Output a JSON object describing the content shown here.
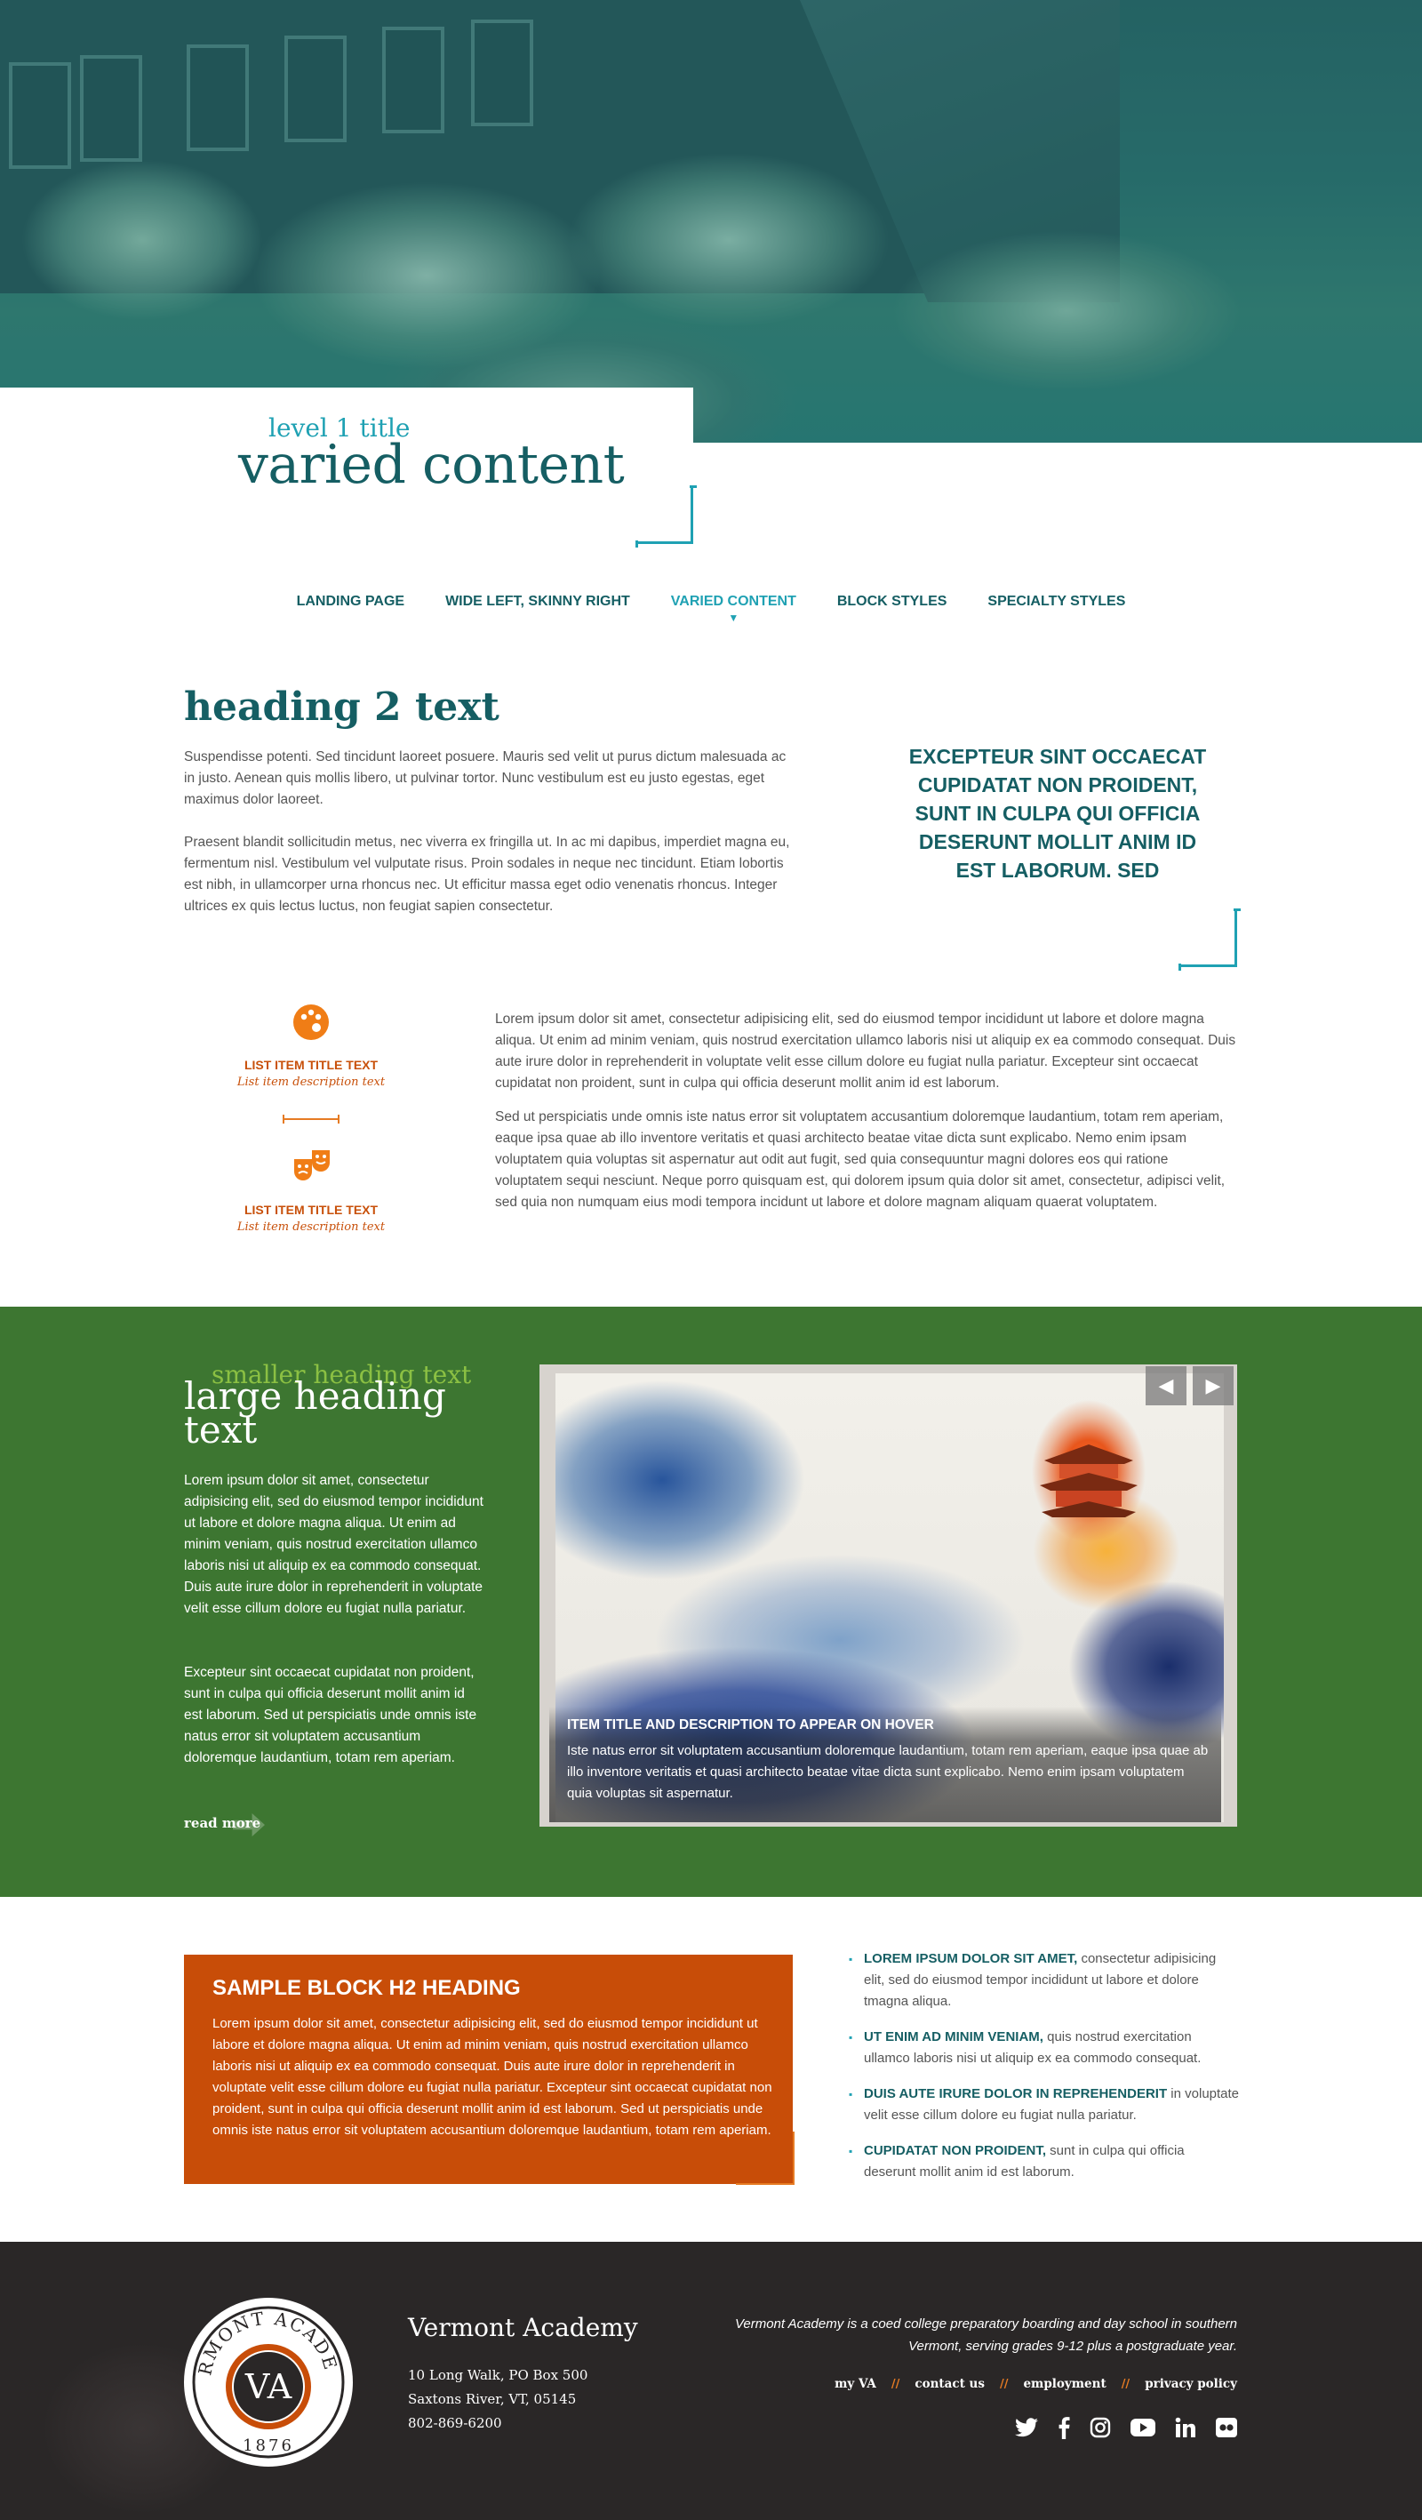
{
  "header": {
    "level1_title": "level 1 title",
    "page_title": "varied content"
  },
  "nav": {
    "items": [
      {
        "label": "LANDING PAGE"
      },
      {
        "label": "WIDE LEFT, SKINNY RIGHT"
      },
      {
        "label": "VARIED CONTENT",
        "active": true
      },
      {
        "label": "BLOCK STYLES"
      },
      {
        "label": "SPECIALTY STYLES"
      }
    ]
  },
  "intro": {
    "heading": "heading 2 text",
    "paragraph1": "Suspendisse potenti. Sed tincidunt laoreet posuere. Mauris sed velit ut purus dictum malesuada ac in justo. Aenean quis mollis libero, ut pulvinar tortor. Nunc vestibulum est eu justo egestas, eget maximus dolor laoreet.",
    "paragraph2": "Praesent blandit sollicitudin metus, nec viverra ex fringilla ut. In ac mi dapibus, imperdiet magna eu, fermentum nisl. Vestibulum vel vulputate risus. Proin sodales in neque nec tincidunt. Etiam lobortis est nibh, in ullamcorper urna rhoncus nec. Ut efficitur massa eget odio venenatis rhoncus. Integer ultrices ex quis lectus luctus, non feugiat sapien consectetur.",
    "pull_quote": "EXCEPTEUR SINT OCCAECAT CUPIDATAT NON PROIDENT, SUNT IN CULPA QUI OFFICIA DESERUNT MOLLIT ANIM ID EST LABORUM. SED"
  },
  "list_items": [
    {
      "icon": "palette-icon",
      "title": "LIST ITEM TITLE TEXT",
      "description": "List item description text"
    },
    {
      "icon": "theater-masks-icon",
      "title": "LIST ITEM TITLE TEXT",
      "description": "List item description text"
    }
  ],
  "body_text": {
    "paragraph1": "Lorem ipsum dolor sit amet, consectetur adipisicing elit, sed do eiusmod tempor incididunt ut labore et dolore magna aliqua. Ut enim ad minim veniam, quis nostrud exercitation ullamco laboris nisi ut aliquip ex ea commodo consequat. Duis aute irure dolor in reprehenderit in voluptate velit esse cillum dolore eu fugiat nulla pariatur. Excepteur sint occaecat cupidatat non proident, sunt in culpa qui officia deserunt mollit anim id est laborum.",
    "paragraph2": "Sed ut perspiciatis unde omnis iste natus error sit voluptatem accusantium doloremque laudantium, totam rem aperiam, eaque ipsa quae ab illo inventore veritatis et quasi architecto beatae vitae dicta sunt explicabo. Nemo enim ipsam voluptatem quia voluptas sit aspernatur aut odit aut fugit, sed quia consequuntur magni dolores eos qui ratione voluptatem sequi nesciunt. Neque porro quisquam est, qui dolorem ipsum quia dolor sit amet, consectetur, adipisci velit, sed quia non numquam eius modi tempora incidunt ut labore et dolore magnam aliquam quaerat voluptatem."
  },
  "feature": {
    "smaller_heading": "smaller heading text",
    "large_heading": "large heading text",
    "paragraph1": "Lorem ipsum dolor sit amet, consectetur adipisicing elit, sed do eiusmod tempor incididunt ut labore et dolore magna aliqua. Ut enim ad minim veniam, quis nostrud exercitation ullamco laboris nisi ut aliquip ex ea commodo consequat. Duis aute irure dolor in reprehenderit in voluptate velit esse cillum dolore eu fugiat nulla pariatur.",
    "paragraph2": "Excepteur sint occaecat cupidatat non proident, sunt in culpa qui officia deserunt mollit anim id est laborum. Sed ut perspiciatis unde omnis iste natus error sit voluptatem accusantium doloremque laudantium, totam rem aperiam.",
    "read_more": "read more",
    "slide": {
      "title": "ITEM TITLE AND DESCRIPTION TO APPEAR ON HOVER",
      "description": "Iste natus error sit voluptatem accusantium doloremque laudantium, totam rem aperiam, eaque ipsa quae ab illo inventore veritatis et quasi architecto beatae vitae dicta sunt explicabo. Nemo enim ipsam voluptatem quia voluptas sit aspernatur."
    },
    "prev_symbol": "◀",
    "next_symbol": "▶"
  },
  "block": {
    "heading": "SAMPLE BLOCK H2 HEADING",
    "text": "Lorem ipsum dolor sit amet, consectetur adipisicing elit, sed do eiusmod tempor incididunt ut labore et dolore magna aliqua. Ut enim ad minim veniam, quis nostrud exercitation ullamco laboris nisi ut aliquip ex ea commodo consequat. Duis aute irure dolor in reprehenderit in voluptate velit esse cillum dolore eu fugiat nulla pariatur. Excepteur sint occaecat cupidatat non proident, sunt in culpa qui officia deserunt mollit anim id est laborum. Sed ut perspiciatis unde omnis iste natus error sit voluptatem accusantium doloremque laudantium, totam rem aperiam."
  },
  "bullets": [
    {
      "lead": "LOREM IPSUM DOLOR SIT AMET,",
      "rest": " consectetur adipisicing elit, sed do eiusmod tempor incididunt ut labore et dolore tmagna aliqua."
    },
    {
      "lead": "UT ENIM AD MINIM VENIAM,",
      "rest": " quis nostrud exercitation ullamco laboris nisi ut aliquip ex ea commodo consequat."
    },
    {
      "lead": "DUIS AUTE IRURE DOLOR IN REPREHENDERIT",
      "rest": " in voluptate velit esse cillum dolore eu fugiat nulla pariatur."
    },
    {
      "lead": "CUPIDATAT NON PROIDENT,",
      "rest": " sunt in culpa qui officia deserunt mollit anim id est laborum."
    }
  ],
  "footer": {
    "seal_text_top": "VERMONT ACADEMY",
    "seal_monogram": "VA",
    "seal_year": "1876",
    "school_name": "Vermont Academy",
    "address_line1": "10 Long Walk, PO Box 500",
    "address_line2": "Saxtons River, VT, 05145",
    "phone": "802-869-6200",
    "tagline": "Vermont Academy is a coed college preparatory boarding and day school in southern Vermont, serving grades 9-12 plus a postgraduate year.",
    "links": [
      "my VA",
      "contact us",
      "employment",
      "privacy policy"
    ],
    "link_separator": "//",
    "socials": [
      "twitter-icon",
      "facebook-icon",
      "instagram-icon",
      "youtube-icon",
      "linkedin-icon",
      "flickr-icon"
    ]
  },
  "colors": {
    "teal_dark": "#155e63",
    "teal_accent": "#1fa1b3",
    "green": "#3d7631",
    "green_light": "#8bc043",
    "orange": "#c84d08",
    "orange_accent": "#e67b23",
    "footer_bg": "#2a2727"
  }
}
